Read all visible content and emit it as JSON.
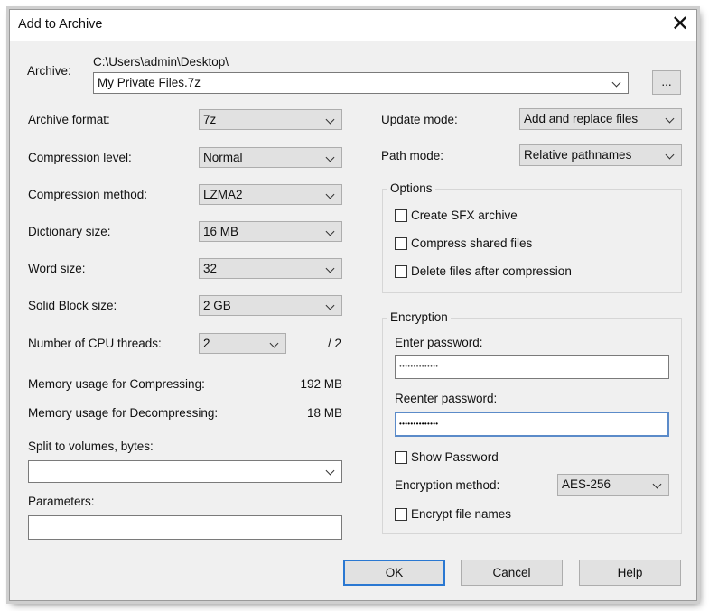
{
  "dialog": {
    "title": "Add to Archive"
  },
  "archive": {
    "label": "Archive:",
    "path": "C:\\Users\\admin\\Desktop\\",
    "filename": "My Private Files.7z",
    "browse_label": "..."
  },
  "left": {
    "archive_format": {
      "label": "Archive format:",
      "value": "7z"
    },
    "compression_level": {
      "label": "Compression level:",
      "value": "Normal"
    },
    "compression_method": {
      "label": "Compression method:",
      "value": "LZMA2"
    },
    "dictionary_size": {
      "label": "Dictionary size:",
      "value": "16 MB"
    },
    "word_size": {
      "label": "Word size:",
      "value": "32"
    },
    "solid_block_size": {
      "label": "Solid Block size:",
      "value": "2 GB"
    },
    "cpu_threads": {
      "label": "Number of CPU threads:",
      "value": "2",
      "max": "/ 2"
    },
    "memory_compress": {
      "label": "Memory usage for Compressing:",
      "value": "192 MB"
    },
    "memory_decompress": {
      "label": "Memory usage for Decompressing:",
      "value": "18 MB"
    },
    "split_volumes": {
      "label": "Split to volumes, bytes:",
      "value": ""
    },
    "parameters": {
      "label": "Parameters:",
      "value": ""
    }
  },
  "right": {
    "update_mode": {
      "label": "Update mode:",
      "value": "Add and replace files"
    },
    "path_mode": {
      "label": "Path mode:",
      "value": "Relative pathnames"
    },
    "options": {
      "title": "Options",
      "create_sfx": "Create SFX archive",
      "compress_shared": "Compress shared files",
      "delete_after": "Delete files after compression"
    },
    "encryption": {
      "title": "Encryption",
      "enter_password_label": "Enter password:",
      "enter_password_mask": "••••••••••••••",
      "reenter_password_label": "Reenter password:",
      "reenter_password_mask": "••••••••••••••",
      "show_password": "Show Password",
      "method_label": "Encryption method:",
      "method_value": "AES-256",
      "encrypt_names": "Encrypt file names"
    }
  },
  "buttons": {
    "ok": "OK",
    "cancel": "Cancel",
    "help": "Help"
  },
  "icons": {
    "close": "close-icon",
    "dropdown": "chevron-down-icon"
  },
  "colors": {
    "dialog_bg": "#f0f0f0",
    "button_bg": "#e1e1e1",
    "default_button_border": "#2a78d2",
    "focus_border": "#5b8bc9"
  }
}
